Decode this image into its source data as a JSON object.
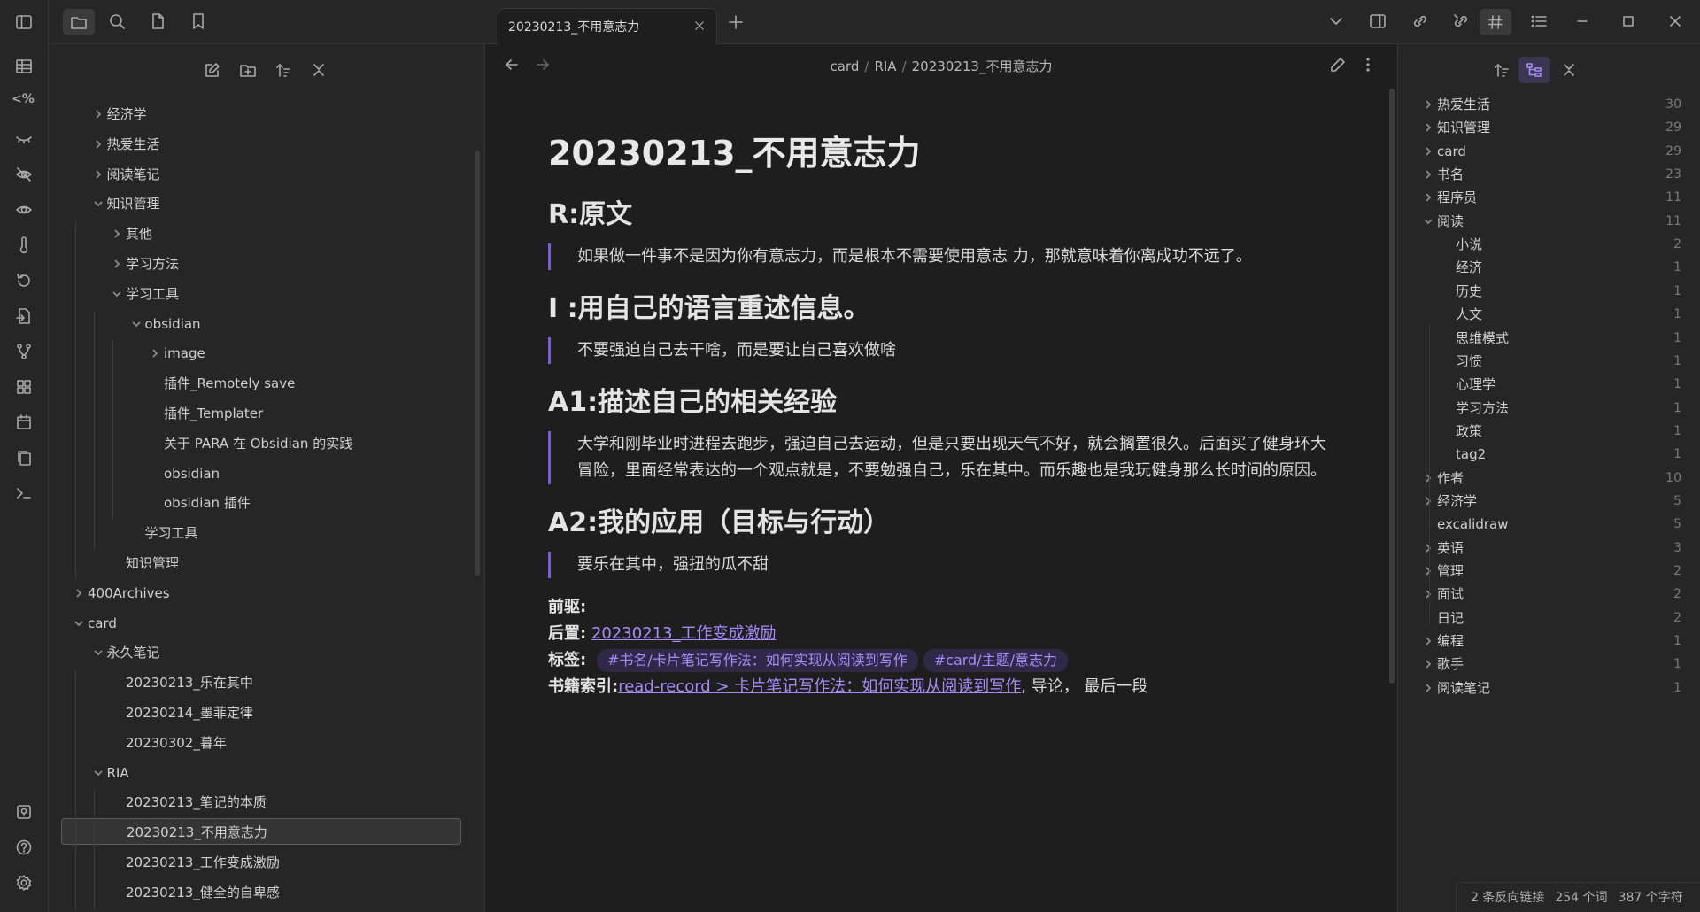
{
  "tab": {
    "title": "20230213_不用意志力"
  },
  "breadcrumb": {
    "a": "card",
    "b": "RIA",
    "c": "20230213_不用意志力"
  },
  "tree": [
    {
      "label": "经济学",
      "depth": 1,
      "chev": "right"
    },
    {
      "label": "热爱生活",
      "depth": 1,
      "chev": "right"
    },
    {
      "label": "阅读笔记",
      "depth": 1,
      "chev": "right"
    },
    {
      "label": "知识管理",
      "depth": 1,
      "chev": "down"
    },
    {
      "label": "其他",
      "depth": 2,
      "chev": "right"
    },
    {
      "label": "学习方法",
      "depth": 2,
      "chev": "right"
    },
    {
      "label": "学习工具",
      "depth": 2,
      "chev": "down"
    },
    {
      "label": "obsidian",
      "depth": 3,
      "chev": "down"
    },
    {
      "label": "image",
      "depth": 4,
      "chev": "right"
    },
    {
      "label": "插件_Remotely save",
      "depth": 4,
      "chev": ""
    },
    {
      "label": "插件_Templater",
      "depth": 4,
      "chev": ""
    },
    {
      "label": "关于 PARA 在 Obsidian 的实践",
      "depth": 4,
      "chev": ""
    },
    {
      "label": "obsidian",
      "depth": 4,
      "chev": ""
    },
    {
      "label": "obsidian 插件",
      "depth": 4,
      "chev": ""
    },
    {
      "label": "学习工具",
      "depth": 3,
      "chev": ""
    },
    {
      "label": "知识管理",
      "depth": 2,
      "chev": ""
    },
    {
      "label": "400Archives",
      "depth": 0,
      "chev": "right"
    },
    {
      "label": "card",
      "depth": 0,
      "chev": "down"
    },
    {
      "label": "永久笔记",
      "depth": 1,
      "chev": "down"
    },
    {
      "label": "20230213_乐在其中",
      "depth": 2,
      "chev": ""
    },
    {
      "label": "20230214_墨菲定律",
      "depth": 2,
      "chev": ""
    },
    {
      "label": "20230302_暮年",
      "depth": 2,
      "chev": ""
    },
    {
      "label": "RIA",
      "depth": 1,
      "chev": "down"
    },
    {
      "label": "20230213_笔记的本质",
      "depth": 2,
      "chev": ""
    },
    {
      "label": "20230213_不用意志力",
      "depth": 2,
      "chev": "",
      "selected": true
    },
    {
      "label": "20230213_工作变成激励",
      "depth": 2,
      "chev": ""
    },
    {
      "label": "20230213_健全的自卑感",
      "depth": 2,
      "chev": ""
    }
  ],
  "note": {
    "title": "20230213_不用意志力",
    "h_r": "R:原文",
    "q_r": "如果做一件事不是因为你有意志力，而是根本不需要使用意志 力，那就意味着你离成功不远了。",
    "h_i": "I :用自己的语言重述信息。",
    "q_i": "不要强迫自己去干啥，而是要让自己喜欢做啥",
    "h_a1": "A1:描述自己的相关经验",
    "q_a1": "大学和刚毕业时进程去跑步，强迫自己去运动，但是只要出现天气不好，就会搁置很久。后面买了健身环大冒险，里面经常表达的一个观点就是，不要勉强自己，乐在其中。而乐趣也是我玩健身那么长时间的原因。",
    "h_a2": "A2:我的应用（目标与行动）",
    "q_a2": "要乐在其中，强扭的瓜不甜",
    "pre_label": "前驱:",
    "post_label": "后置:",
    "post_link": "20230213_工作变成激励",
    "tags_label": "标签:",
    "tag1": "#书名/卡片笔记写作法：如何实现从阅读到写作",
    "tag2": "#card/主题/意志力",
    "index_label": "书籍索引:",
    "index_link": "read-record > 卡片笔记写作法：如何实现从阅读到写作",
    "index_tail": ", 导论，  最后一段"
  },
  "tags_panel": [
    {
      "label": "热爱生活",
      "count": "30",
      "depth": 0,
      "chev": "right"
    },
    {
      "label": "知识管理",
      "count": "29",
      "depth": 0,
      "chev": "right"
    },
    {
      "label": "card",
      "count": "29",
      "depth": 0,
      "chev": "right"
    },
    {
      "label": "书名",
      "count": "23",
      "depth": 0,
      "chev": "right"
    },
    {
      "label": "程序员",
      "count": "11",
      "depth": 0,
      "chev": "right"
    },
    {
      "label": "阅读",
      "count": "11",
      "depth": 0,
      "chev": "down"
    },
    {
      "label": "小说",
      "count": "2",
      "depth": 1,
      "chev": ""
    },
    {
      "label": "经济",
      "count": "1",
      "depth": 1,
      "chev": ""
    },
    {
      "label": "历史",
      "count": "1",
      "depth": 1,
      "chev": ""
    },
    {
      "label": "人文",
      "count": "1",
      "depth": 1,
      "chev": ""
    },
    {
      "label": "思维模式",
      "count": "1",
      "depth": 1,
      "chev": ""
    },
    {
      "label": "习惯",
      "count": "1",
      "depth": 1,
      "chev": ""
    },
    {
      "label": "心理学",
      "count": "1",
      "depth": 1,
      "chev": ""
    },
    {
      "label": "学习方法",
      "count": "1",
      "depth": 1,
      "chev": ""
    },
    {
      "label": "政策",
      "count": "1",
      "depth": 1,
      "chev": ""
    },
    {
      "label": "tag2",
      "count": "1",
      "depth": 1,
      "chev": ""
    },
    {
      "label": "作者",
      "count": "10",
      "depth": 0,
      "chev": "right"
    },
    {
      "label": "经济学",
      "count": "5",
      "depth": 0,
      "chev": "right"
    },
    {
      "label": "excalidraw",
      "count": "5",
      "depth": 0,
      "chev": ""
    },
    {
      "label": "英语",
      "count": "3",
      "depth": 0,
      "chev": "right"
    },
    {
      "label": "管理",
      "count": "2",
      "depth": 0,
      "chev": "right"
    },
    {
      "label": "面试",
      "count": "2",
      "depth": 0,
      "chev": "right"
    },
    {
      "label": "日记",
      "count": "2",
      "depth": 0,
      "chev": ""
    },
    {
      "label": "编程",
      "count": "1",
      "depth": 0,
      "chev": "right"
    },
    {
      "label": "歌手",
      "count": "1",
      "depth": 0,
      "chev": "right"
    },
    {
      "label": "阅读笔记",
      "count": "1",
      "depth": 0,
      "chev": "right"
    }
  ],
  "status": {
    "backlinks": "2 条反向链接",
    "words": "254 个词",
    "chars": "387 个字符"
  },
  "colors": {
    "accent": "#a78bfa",
    "quote_border": "#7c5cd9",
    "bg": "#1e1e1e",
    "panel": "#262626"
  }
}
